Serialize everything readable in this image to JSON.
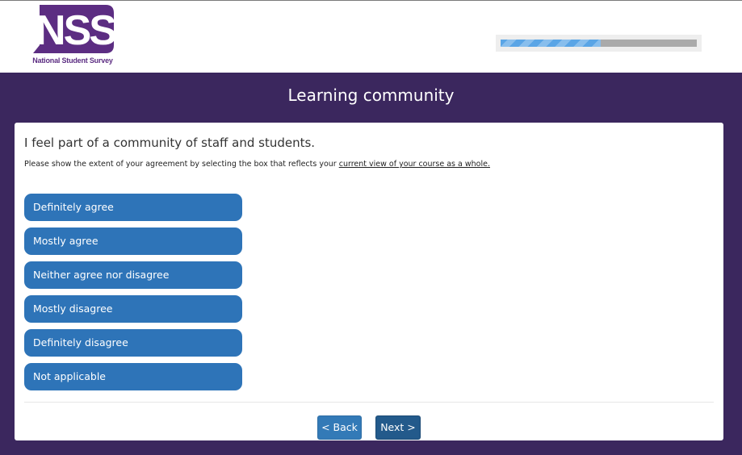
{
  "header": {
    "logo": {
      "text": "NSS",
      "subtitle": "National Student Survey",
      "brand_color": "#5c2d82"
    },
    "progress": {
      "fraction": 0.51,
      "fill_color": "#5aa5e6",
      "track_color": "#aaaaaa"
    }
  },
  "section": {
    "title": "Learning community"
  },
  "question": {
    "text": "I feel part of a community of staff and students.",
    "instructions_prefix": "Please show the extent of your agreement by selecting the box that reflects your ",
    "instructions_emphasis": "current view of your course as a whole."
  },
  "options": [
    {
      "label": "Definitely agree"
    },
    {
      "label": "Mostly agree"
    },
    {
      "label": "Neither agree nor disagree"
    },
    {
      "label": "Mostly disagree"
    },
    {
      "label": "Definitely disagree"
    },
    {
      "label": "Not applicable"
    }
  ],
  "nav": {
    "back_label": "< Back",
    "next_label": "Next >"
  },
  "colors": {
    "page_background": "#3b275e",
    "option_button": "#2e74b8",
    "back_button": "#337ab7",
    "next_button": "#235a8b"
  }
}
